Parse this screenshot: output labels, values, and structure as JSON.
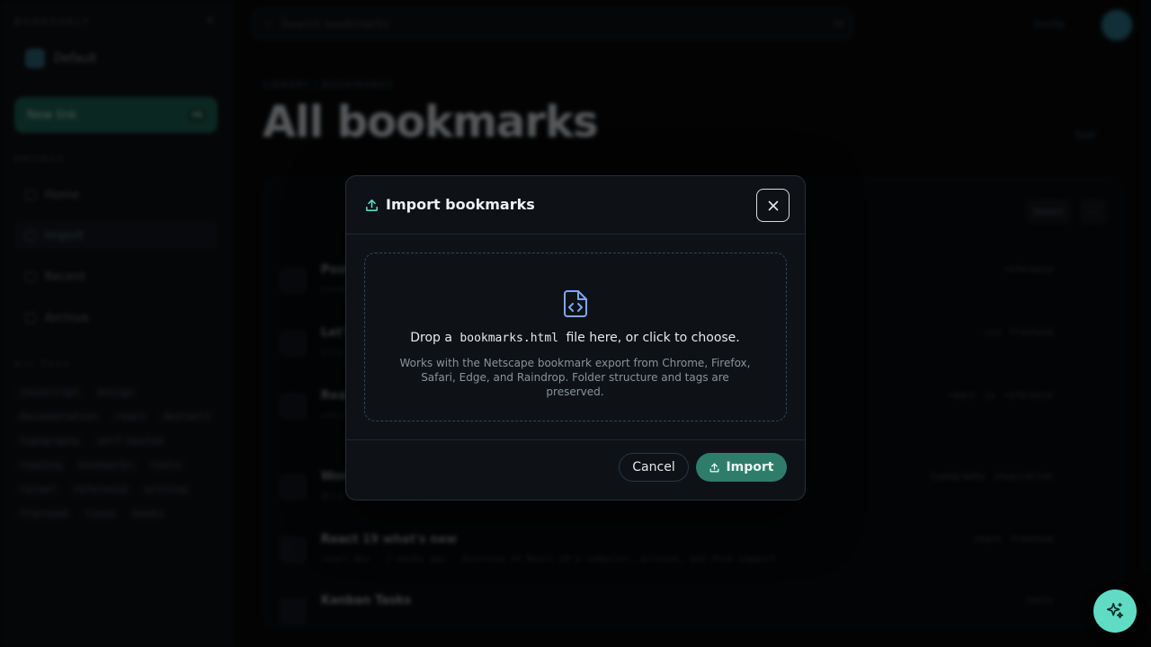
{
  "sidebar": {
    "brand": "BOOKSHELF",
    "workspace": "Default",
    "new_button": "New link",
    "new_shortcut": "⌘N",
    "section_nav": "BROWSE",
    "nav": [
      {
        "label": "Home"
      },
      {
        "label": "Import"
      },
      {
        "label": "Recent"
      },
      {
        "label": "Archive"
      }
    ],
    "section_tags": "ALL TAGS",
    "tags": [
      "javascript",
      "design",
      "documentation",
      "react",
      "devtools",
      "typography",
      "self-hosted",
      "reading",
      "bookmarks",
      "tools",
      "career",
      "reference",
      "writing",
      "frontend",
      "linux",
      "books"
    ]
  },
  "topbar": {
    "search_placeholder": "Search bookmarks",
    "shortcut": "⌘K",
    "right_label": "Invite"
  },
  "page": {
    "breadcrumb": "LIBRARY  /  BOOKMARKS",
    "title": "All bookmarks",
    "count": "Sort"
  },
  "list": {
    "toolbar": [
      "Select",
      "⋯"
    ],
    "rows": [
      {
        "title": "Post",
        "meta": "example.org · 2 days ago",
        "tags": [
          "reference"
        ]
      },
      {
        "title": "Let's",
        "meta": "blog.dev · 3 days ago",
        "tags": [
          "css",
          "frontend"
        ]
      },
      {
        "title": "Read",
        "meta": "news.site · 5 days ago",
        "tags": [
          "react",
          "js",
          "reference"
        ]
      },
      {
        "title": "Work",
        "meta": "docs.site · 1 week ago",
        "tags": [
          "typography",
          "inspiration"
        ]
      },
      {
        "title": "React 19 what's new",
        "meta": "react.dev · 2 weeks ago · Overview of React 19's compiler, actions, and form support",
        "tags": [
          "react",
          "frontend"
        ]
      },
      {
        "title": "Kanban Tasks",
        "meta": "",
        "tags": [
          "tools"
        ]
      }
    ]
  },
  "modal": {
    "title": "Import bookmarks",
    "drop_prefix": "Drop a",
    "drop_filename": "bookmarks.html",
    "drop_suffix": "file here, or click to choose.",
    "help": "Works with the Netscape bookmark export from Chrome, Firefox, Safari, Edge, and Raindrop. Folder structure and tags are preserved.",
    "cancel_label": "Cancel",
    "import_label": "Import"
  },
  "icons": {
    "modal_title": "upload-icon",
    "close": "close-icon",
    "dropzone": "file-code-icon",
    "import_button": "upload-icon",
    "fab": "sparkles-icon"
  },
  "colors": {
    "accent": "#2e7d6b",
    "accent_light": "#5fdcc3",
    "icon_blue": "#7aa7f5",
    "modal_bg": "#0e1217"
  }
}
